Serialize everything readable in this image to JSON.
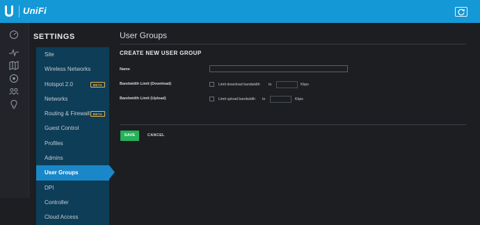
{
  "app": {
    "brand": "UniFi"
  },
  "settings": {
    "title": "SETTINGS",
    "menu": [
      {
        "label": "Site",
        "active": false,
        "beta": ""
      },
      {
        "label": "Wireless Networks",
        "active": false,
        "beta": ""
      },
      {
        "label": "Hotspot 2.0",
        "active": false,
        "beta": "BETA"
      },
      {
        "label": "Networks",
        "active": false,
        "beta": ""
      },
      {
        "label": "Routing & Firewall",
        "active": false,
        "beta": "BETA"
      },
      {
        "label": "Guest Control",
        "active": false,
        "beta": ""
      },
      {
        "label": "Profiles",
        "active": false,
        "beta": ""
      },
      {
        "label": "Admins",
        "active": false,
        "beta": ""
      },
      {
        "label": "User Groups",
        "active": true,
        "beta": ""
      },
      {
        "label": "DPI",
        "active": false,
        "beta": ""
      },
      {
        "label": "Controller",
        "active": false,
        "beta": ""
      },
      {
        "label": "Cloud Access",
        "active": false,
        "beta": ""
      }
    ]
  },
  "main": {
    "page_title": "User Groups",
    "section_title": "CREATE NEW USER GROUP",
    "name": {
      "label": "Name",
      "value": ""
    },
    "download": {
      "label": "Bandwidth Limit (Download)",
      "checkbox_label": "Limit download bandwidth",
      "to": "to",
      "value": "",
      "unit": "Kbps"
    },
    "upload": {
      "label": "Bandwidth Limit (Upload)",
      "checkbox_label": "Limit upload bandwidth",
      "to": "to",
      "value": "",
      "unit": "Kbps"
    },
    "save_label": "SAVE",
    "cancel_label": "CANCEL"
  },
  "colors": {
    "topbar": "#1499d6",
    "menu_bg": "#0d3d57",
    "menu_active": "#1a87c8",
    "save": "#27b05a",
    "beta": "#f2b445"
  },
  "icons": {
    "logo": "ubiquiti-u-logo-icon",
    "refresh": "refresh-icon",
    "nav": [
      "dashboard-icon",
      "statistics-icon",
      "map-icon",
      "devices-icon",
      "clients-icon",
      "insights-icon"
    ]
  }
}
